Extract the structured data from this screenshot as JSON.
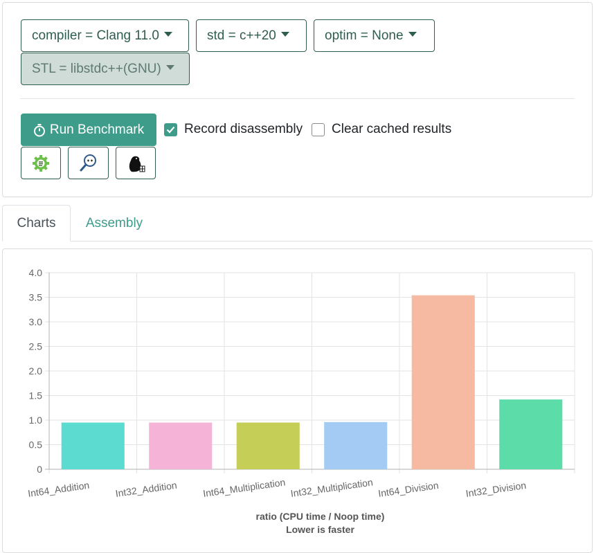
{
  "filters": {
    "compiler": "compiler = Clang 11.0",
    "std": "std = c++20",
    "optim": "optim = None",
    "stl": "STL = libstdc++(GNU)"
  },
  "actions": {
    "run_label": "Run Benchmark",
    "record_disassembly_label": "Record disassembly",
    "record_disassembly_checked": true,
    "clear_cache_label": "Clear cached results",
    "clear_cache_checked": false
  },
  "icon_buttons": [
    "settings-gear-icon",
    "cpp-search-icon",
    "beaver-icon"
  ],
  "tabs": [
    {
      "label": "Charts",
      "active": true
    },
    {
      "label": "Assembly",
      "active": false
    }
  ],
  "chart_data": {
    "type": "bar",
    "categories": [
      "Int64_Addition",
      "Int32_Addition",
      "Int64_Multiplication",
      "Int32_Multiplication",
      "Int64_Division",
      "Int32_Division"
    ],
    "values": [
      0.95,
      0.95,
      0.95,
      0.96,
      3.54,
      1.42
    ],
    "colors": [
      "#5cdbd0",
      "#f5b3d8",
      "#c5cf58",
      "#a3cbf4",
      "#f6b9a1",
      "#5cdca8"
    ],
    "ylim": [
      0,
      4.0
    ],
    "yticks": [
      "0",
      "0.5",
      "1.0",
      "1.5",
      "2.0",
      "2.5",
      "3.0",
      "3.5",
      "4.0"
    ],
    "ytick_values": [
      0,
      0.5,
      1.0,
      1.5,
      2.0,
      2.5,
      3.0,
      3.5,
      4.0
    ],
    "xlabel": "ratio (CPU time / Noop time)",
    "xlabel2": "Lower is faster",
    "grid": true
  }
}
